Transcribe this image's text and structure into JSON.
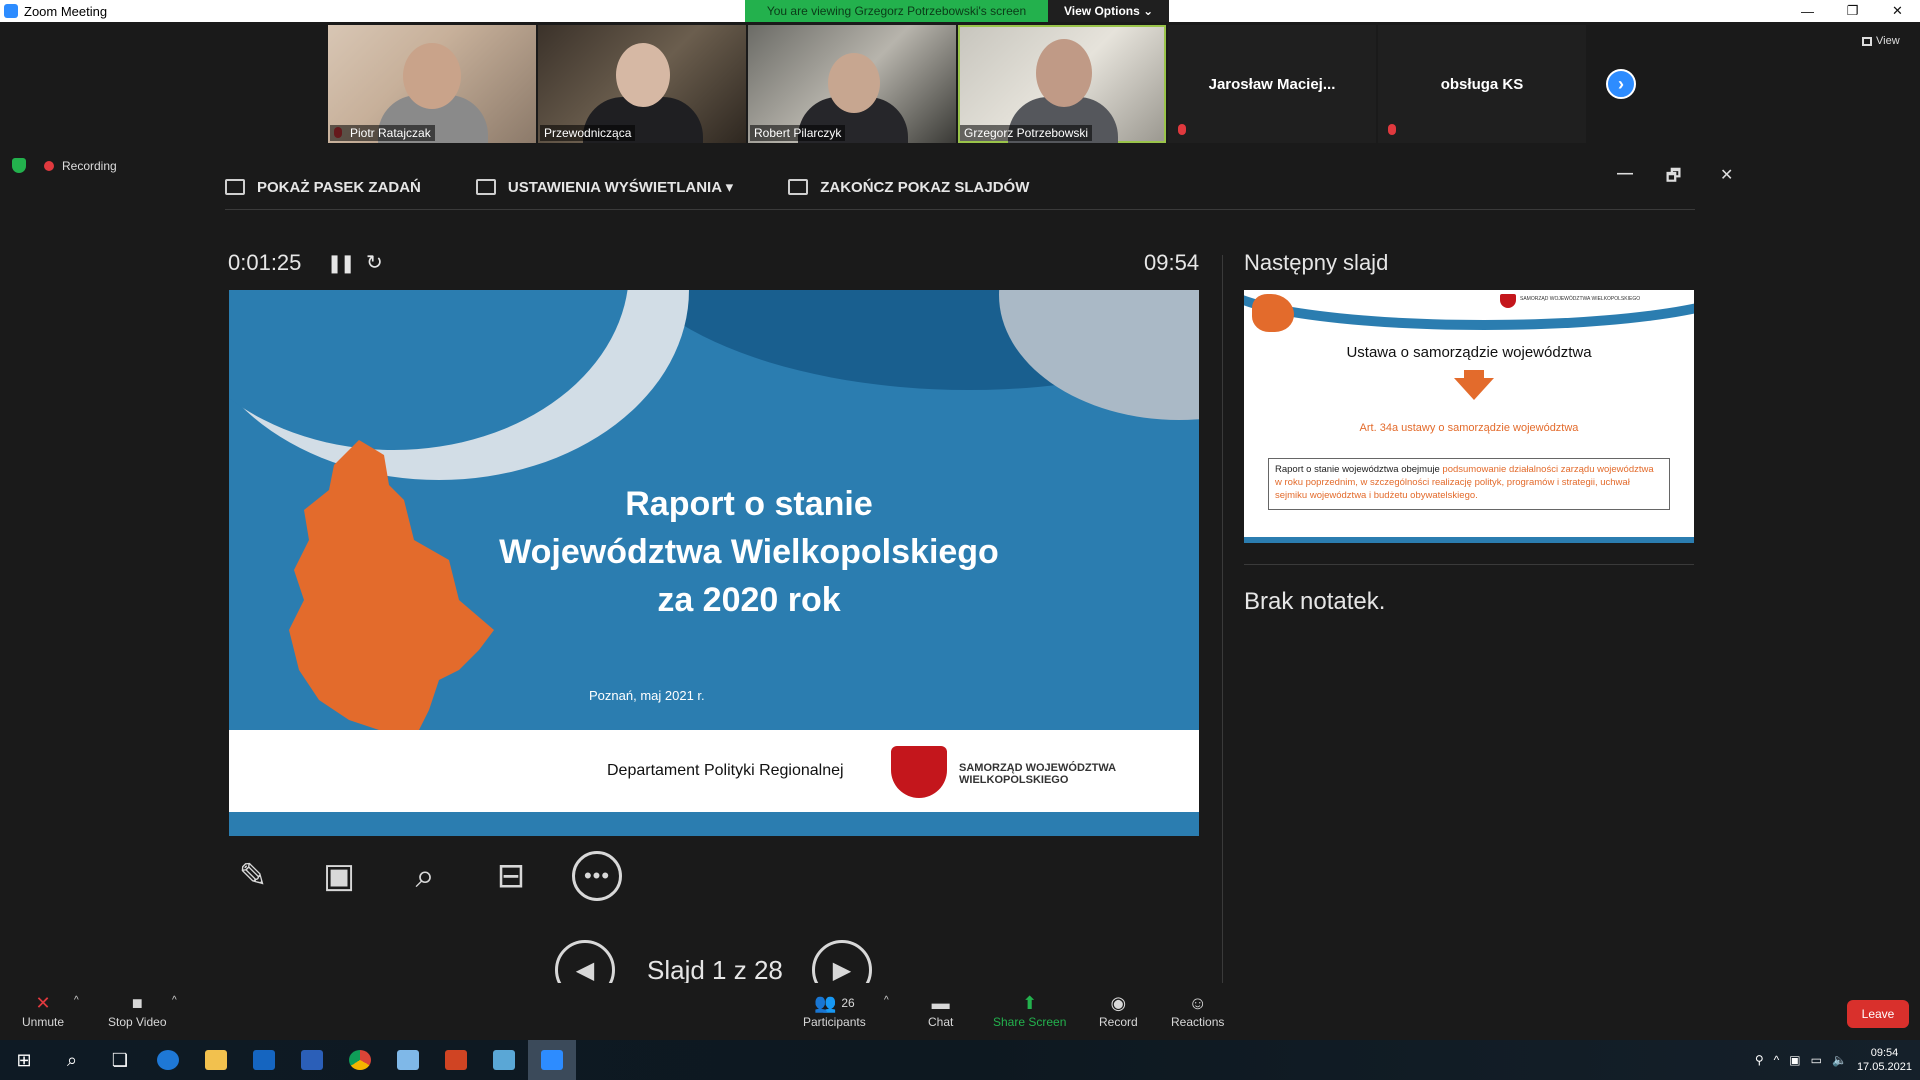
{
  "window": {
    "title": "Zoom Meeting",
    "viewing_banner": "You are viewing Grzegorz Potrzebowski's screen",
    "view_options": "View Options ⌄",
    "minimize": "—",
    "restore": "❐",
    "close": "✕"
  },
  "gallery": {
    "participants": [
      {
        "name": "Piotr Ratajczak"
      },
      {
        "name": "Przewodnicząca"
      },
      {
        "name": "Robert Pilarczyk"
      },
      {
        "name": "Grzegorz Potrzebowski"
      }
    ],
    "blank_tiles": [
      {
        "name": "Jarosław  Maciej..."
      },
      {
        "name": "obsługa KS"
      }
    ],
    "next_arrow": "›",
    "view_label": "View"
  },
  "recording": {
    "label": "Recording"
  },
  "presenter_toolbar": {
    "show_taskbar": "POKAŻ PASEK ZADAŃ",
    "display_settings": "USTAWIENIA WYŚWIETLANIA ▾",
    "end_slideshow": "ZAKOŃCZ POKAZ SLAJDÓW",
    "win_min": "—",
    "win_restore": "🗗",
    "win_close": "✕"
  },
  "presenter": {
    "timer": "0:01:25",
    "pause_icon": "❚❚",
    "reset_icon": "↻",
    "clock": "09:54",
    "slide_counter": "Slajd 1 z 28",
    "prev_icon": "◀",
    "next_icon": "▶",
    "next_slide_label": "Następny slajd",
    "notes": "Brak notatek.",
    "tools": {
      "pen": "✎",
      "grid": "▣",
      "zoom": "⌕",
      "blank_screen": "⊟",
      "more": "•••"
    }
  },
  "current_slide": {
    "title_line1": "Raport o stanie",
    "title_line2": "Województwa Wielkopolskiego",
    "title_line3": "za 2020 rok",
    "subtitle": "Poznań, maj 2021 r.",
    "department": "Departament Polityki Regionalnej",
    "org_line1": "SAMORZĄD  WOJEWÓDZTWA",
    "org_line2": "WIELKOPOLSKIEGO"
  },
  "next_slide": {
    "heading": "Ustawa o samorządzie województwa",
    "article": "Art. 34a ustawy o samorządzie województwa",
    "body_prefix": "Raport o stanie województwa obejmuje ",
    "body_highlight": "podsumowanie działalności zarządu województwa w roku poprzednim, w szczególności realizację polityk, programów i strategii, uchwał sejmiku województwa i budżetu obywatelskiego.",
    "mini_org": "SAMORZĄD WOJEWÓDZTWA WIELKOPOLSKIEGO"
  },
  "meeting_controls": {
    "unmute": "Unmute",
    "stop_video": "Stop Video",
    "participants": "Participants",
    "participants_count": "26",
    "chat": "Chat",
    "share_screen": "Share Screen",
    "record": "Record",
    "reactions": "Reactions",
    "leave": "Leave"
  },
  "taskbar": {
    "start_icon": "⊞",
    "search_icon": "⌕",
    "taskview_icon": "❏",
    "time": "09:54",
    "date": "17.05.2021"
  },
  "colors": {
    "zoom_blue": "#2d8cff",
    "banner_green": "#23b14d",
    "slide_blue": "#2b7db0",
    "slide_orange": "#e36b2c",
    "leave_red": "#d9302c"
  }
}
